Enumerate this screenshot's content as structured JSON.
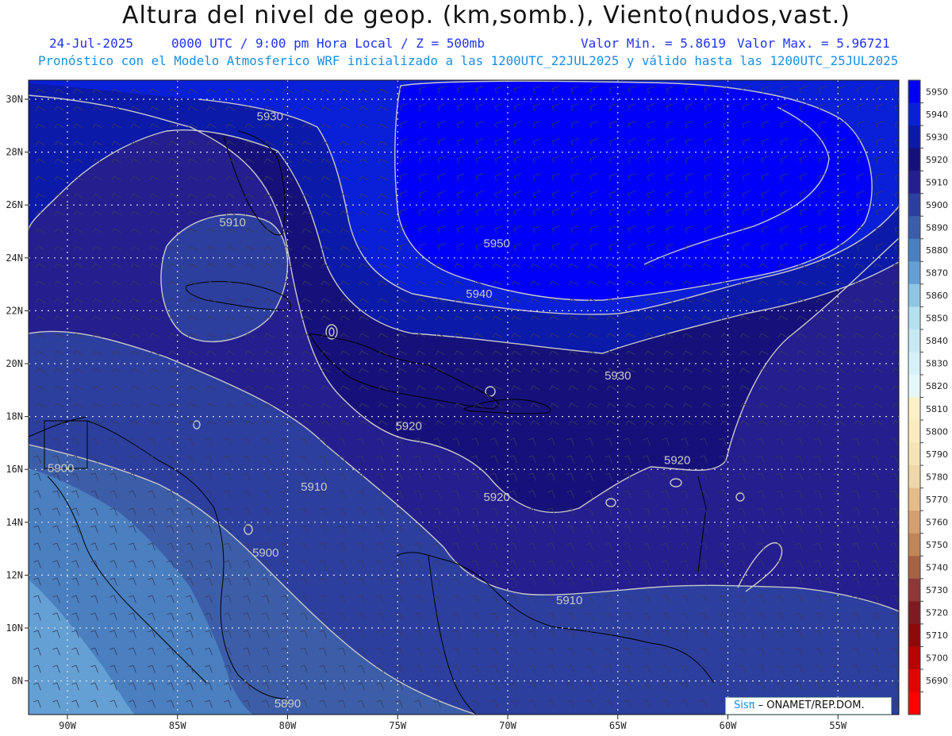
{
  "title": "Altura del nivel de geop. (km,somb.), Viento(nudos,vast.)",
  "subtitle": {
    "date": "24-Jul-2025",
    "time": "0000 UTC / 9:00 pm Hora Local / Z = 500mb",
    "min": "Valor Min. = 5.8619",
    "max": "Valor Max. = 5.96721",
    "model": "Pronóstico con el Modelo Atmosferico WRF inicializado a las 1200UTC_22JUL2025 y válido hasta las  1200UTC_25JUL2025"
  },
  "colors": {
    "subtitle_blue": "#2233ee",
    "model_cyan": "#1a8fe0"
  },
  "map": {
    "lat_labels": [
      "30N",
      "28N",
      "26N",
      "24N",
      "22N",
      "20N",
      "18N",
      "16N",
      "14N",
      "12N",
      "10N",
      "8N"
    ],
    "lon_labels": [
      "90W",
      "85W",
      "80W",
      "75W",
      "70W",
      "65W",
      "60W",
      "55W"
    ],
    "contour_labels": [
      {
        "text": "5930",
        "lon": -80.8,
        "lat": 29.2
      },
      {
        "text": "5950",
        "lon": -70.5,
        "lat": 24.4
      },
      {
        "text": "5940",
        "lon": -71.3,
        "lat": 22.5
      },
      {
        "text": "5910",
        "lon": -82.5,
        "lat": 25.2
      },
      {
        "text": "5930",
        "lon": -65.0,
        "lat": 19.4
      },
      {
        "text": "5920",
        "lon": -74.5,
        "lat": 17.5
      },
      {
        "text": "5920",
        "lon": -62.3,
        "lat": 16.2
      },
      {
        "text": "5920",
        "lon": -70.5,
        "lat": 14.8
      },
      {
        "text": "5910",
        "lon": -78.8,
        "lat": 15.2
      },
      {
        "text": "5900",
        "lon": -90.3,
        "lat": 15.9
      },
      {
        "text": "5900",
        "lon": -81.0,
        "lat": 12.7
      },
      {
        "text": "5910",
        "lon": -67.2,
        "lat": 10.9
      },
      {
        "text": "5890",
        "lon": -80.0,
        "lat": 7.0
      }
    ]
  },
  "colorbar": {
    "levels": [
      "5950",
      "5940",
      "5930",
      "5920",
      "5910",
      "5900",
      "5890",
      "5880",
      "5870",
      "5860",
      "5850",
      "5840",
      "5830",
      "5820",
      "5810",
      "5800",
      "5790",
      "5780",
      "5770",
      "5760",
      "5750",
      "5740",
      "5730",
      "5720",
      "5710",
      "5700",
      "5690"
    ],
    "colors": [
      "#0000fa",
      "#0a1fd8",
      "#0c1aaa",
      "#16117a",
      "#241e8f",
      "#2c3f9f",
      "#3c5ea8",
      "#4a7fc0",
      "#64a0d4",
      "#90c5e4",
      "#b4e0ef",
      "#c6eaf4",
      "#d6f2f8",
      "#e4f8fc",
      "#fcf0c6",
      "#faecc0",
      "#f6e4b8",
      "#f0d6a8",
      "#e4bc88",
      "#d4a070",
      "#c08658",
      "#a66244",
      "#8e3838",
      "#7e1a22",
      "#8c0a0a",
      "#b80404",
      "#e20202",
      "#ff0000"
    ]
  },
  "credit": {
    "logo": "Sisπ",
    "text": "– ONAMET/REP.DOM."
  }
}
